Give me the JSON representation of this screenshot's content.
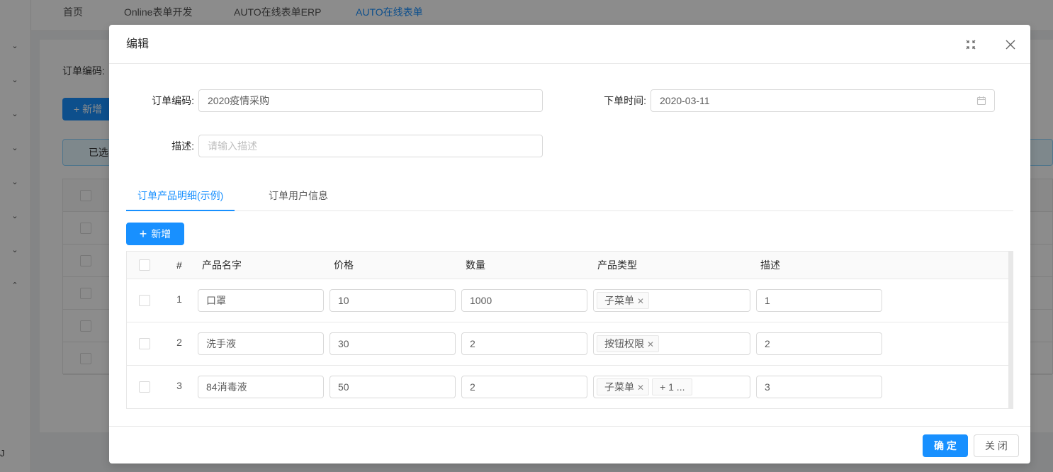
{
  "background": {
    "nav_tabs": [
      "首页",
      "Online表单开发",
      "AUTO在线表单ERP",
      "AUTO在线表单"
    ],
    "active_tab_index": 3,
    "filter_label": "订单编码:",
    "add_button": "+ 新增",
    "alert_text": "已选",
    "bottom_char": "J"
  },
  "modal": {
    "title": "编辑",
    "form": {
      "order_code_label": "订单编码:",
      "order_code_value": "2020疫情采购",
      "order_time_label": "下单时间:",
      "order_time_value": "2020-03-11",
      "desc_label": "描述:",
      "desc_placeholder": "请输入描述"
    },
    "tabs": [
      "订单产品明细(示例)",
      "订单用户信息"
    ],
    "active_tab_index": 0,
    "add_button": "新增",
    "table": {
      "headers": [
        "#",
        "产品名字",
        "价格",
        "数量",
        "产品类型",
        "描述"
      ],
      "rows": [
        {
          "index": "1",
          "name": "口罩",
          "price": "10",
          "qty": "1000",
          "types": [
            "子菜单"
          ],
          "more": "",
          "desc": "1"
        },
        {
          "index": "2",
          "name": "洗手液",
          "price": "30",
          "qty": "2",
          "types": [
            "按钮权限"
          ],
          "more": "",
          "desc": "2"
        },
        {
          "index": "3",
          "name": "84消毒液",
          "price": "50",
          "qty": "2",
          "types": [
            "子菜单"
          ],
          "more": "+ 1 ...",
          "desc": "3"
        }
      ]
    },
    "footer": {
      "ok_label": "确 定",
      "close_label": "关 闭"
    }
  },
  "colors": {
    "primary": "#1890ff",
    "border": "#d9d9d9",
    "mask": "rgba(0,0,0,0.45)"
  }
}
